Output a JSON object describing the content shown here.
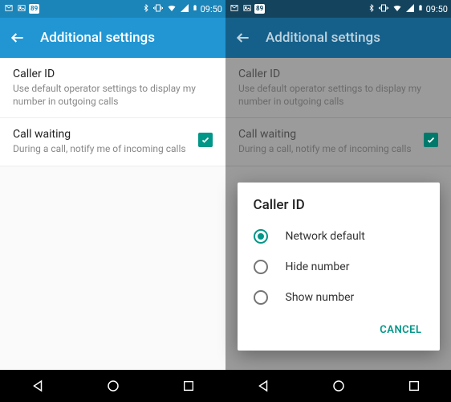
{
  "statusbar": {
    "battery_badge": "89",
    "time": "09:50"
  },
  "appbar": {
    "title": "Additional settings"
  },
  "settings": {
    "caller_id": {
      "title": "Caller ID",
      "sub": "Use default operator settings to display my number in outgoing calls"
    },
    "call_waiting": {
      "title": "Call waiting",
      "sub": "During a call, notify me of incoming calls",
      "checked": true
    }
  },
  "dialog": {
    "title": "Caller ID",
    "options": [
      {
        "label": "Network default",
        "selected": true
      },
      {
        "label": "Hide number",
        "selected": false
      },
      {
        "label": "Show number",
        "selected": false
      }
    ],
    "cancel": "CANCEL"
  }
}
